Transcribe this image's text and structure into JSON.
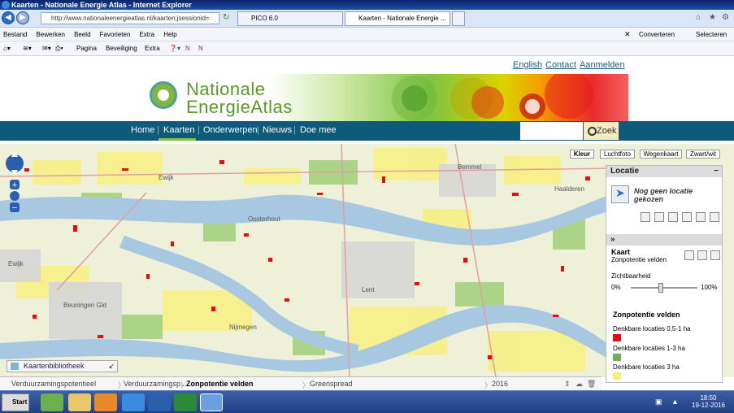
{
  "window": {
    "title": "Kaarten - Nationale Energie Atlas - Internet Explorer"
  },
  "browser": {
    "address": "http://www.nationaleenergieatlas.nl/kaarten;jsessionid=",
    "tabs": [
      {
        "label": "PICO 6.0"
      },
      {
        "label": "Kaarten - Nationale Energie ..."
      }
    ],
    "menu": [
      "Bestand",
      "Bewerken",
      "Beeld",
      "Favorieten",
      "Extra",
      "Help"
    ],
    "right_tools": {
      "convert": "Converteren",
      "select": "Selecteren"
    },
    "command": {
      "page": "Pagina",
      "security": "Beveiliging",
      "extra": "Extra"
    }
  },
  "site": {
    "top_links": [
      "English",
      "Contact",
      "Aanmelden"
    ],
    "logo": {
      "line1": "Nationale",
      "line2": "EnergieAtlas"
    },
    "nav": [
      "Home",
      "Kaarten",
      "Onderwerpen",
      "Nieuws",
      "Doe mee"
    ],
    "search_label": "Zoek"
  },
  "map": {
    "basemaps": [
      "Kleur",
      "Luchtfoto",
      "Wegenkaart",
      "Zwart/wit"
    ],
    "active_basemap": "Kleur",
    "place_labels": [
      "Ewijk",
      "Beuningen Gld",
      "Ewijk",
      "Oosterhout",
      "Lent",
      "Nijmegen",
      "Bemmel",
      "Haalderen"
    ]
  },
  "panel": {
    "location_title": "Locatie",
    "location_text": "Nog geen locatie gekozen",
    "map_title": "Kaart",
    "map_subtitle": "Zonpotentie velden",
    "visibility_label": "Zichtbaarheid",
    "visibility_min": "0%",
    "visibility_max": "100%",
    "visibility_value": 0.45,
    "legend_title": "Zonpotentie velden",
    "legend": [
      {
        "label": "Denkbare locaties 0,5-1 ha",
        "color": "#e01010"
      },
      {
        "label": "Denkbare locaties 1-3 ha",
        "color": "#6fae5a"
      },
      {
        "label": "Denkbare locaties 3 ha",
        "color": "#f5ef7a"
      }
    ]
  },
  "bottom": {
    "library": "Kaartenbibliotheek",
    "breadcrumb": [
      "Verduurzamingspotentieel",
      "Verduurzamingsp...",
      "Zonpotentie velden",
      "Greenspread",
      "2016"
    ]
  },
  "taskbar": {
    "start": "Start",
    "time": "18:50",
    "date": "19-12-2016"
  }
}
